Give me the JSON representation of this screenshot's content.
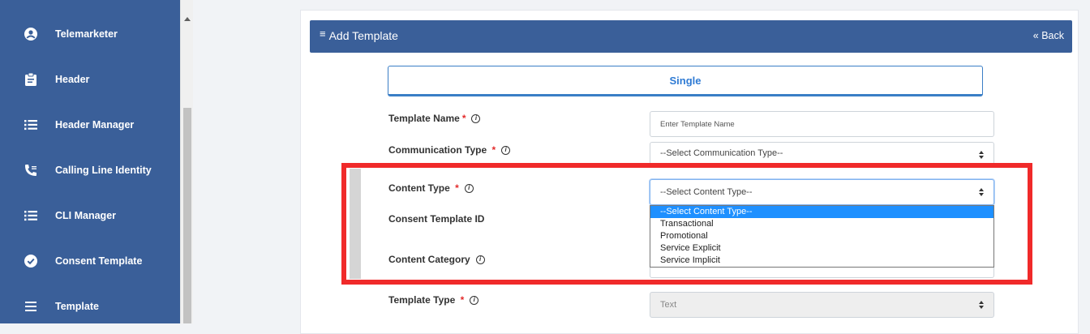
{
  "sidebar": {
    "items": [
      {
        "label": "Telemarketer",
        "icon": "user-circle-icon"
      },
      {
        "label": "Header",
        "icon": "clipboard-icon"
      },
      {
        "label": "Header Manager",
        "icon": "list-icon"
      },
      {
        "label": "Calling Line Identity",
        "icon": "phone-icon"
      },
      {
        "label": "CLI Manager",
        "icon": "list-icon"
      },
      {
        "label": "Consent Template",
        "icon": "check-circle-icon"
      },
      {
        "label": "Template",
        "icon": "bars-icon"
      }
    ]
  },
  "card": {
    "title": "Add Template",
    "back_label": "« Back",
    "tab_label": "Single"
  },
  "form": {
    "template_name": {
      "label": "Template Name",
      "placeholder": "Enter Template Name"
    },
    "communication_type": {
      "label": "Communication Type",
      "value": "--Select Communication Type--"
    },
    "content_type": {
      "label": "Content Type",
      "value": "--Select Content Type--"
    },
    "consent_template_id": {
      "label": "Consent Template ID"
    },
    "content_category": {
      "label": "Content Category"
    },
    "template_type": {
      "label": "Template Type",
      "value": "Text"
    }
  },
  "content_type_dropdown": {
    "options": [
      "--Select Content Type--",
      "Transactional",
      "Promotional",
      "Service Explicit",
      "Service Implicit"
    ],
    "selected_index": 0
  },
  "colors": {
    "sidebar_bg": "#3a5f99",
    "header_bg": "#3a5f99",
    "tab_accent": "#2f7bd4",
    "highlight": "#f02a2a",
    "option_selected": "#1e90ff"
  }
}
